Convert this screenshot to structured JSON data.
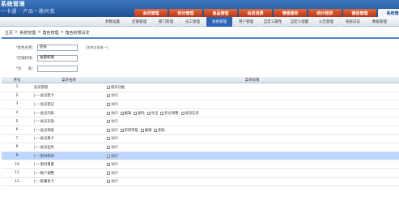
{
  "app": {
    "title": "系统管理",
    "slogan": "一卡通 · 产品一路同我"
  },
  "main_nav": [
    "会员管理",
    "积分管理",
    "商品管理",
    "会员消费",
    "增值服务",
    "统计报表",
    "微信管理",
    "系统管理"
  ],
  "active_main": 7,
  "sub_nav": [
    "参数设置",
    "店铺管理",
    "部门管理",
    "员工管理",
    "角色管理",
    "用户管理",
    "自定义属性",
    "自定义提醒",
    "公告管理",
    "系统日志",
    "数据管理"
  ],
  "active_sub": 4,
  "breadcrumb": [
    "主页",
    "系统管理",
    "角色管理",
    "角色权限设定"
  ],
  "form": {
    "name_label": "*角色名称：",
    "name_value": "店长",
    "hint": "[名称全局唯一]",
    "shop_label": "*店铺权限：",
    "shop_value": "总部权限",
    "remark_label": "*功　　能："
  },
  "table": {
    "headers": {
      "idx": "序号",
      "name": "菜单名称",
      "perm": "菜单权限"
    },
    "rows": [
      {
        "idx": "1",
        "name": "会员管理",
        "perms": [
          "模块功能"
        ]
      },
      {
        "idx": "2",
        "name": "|----会员登卡",
        "perms": [
          "访问"
        ]
      },
      {
        "idx": "3",
        "name": "|----会员登记",
        "perms": [
          "访问"
        ]
      },
      {
        "idx": "4",
        "name": "|----会员列表",
        "perms": [
          "访问",
          "编辑",
          "删除",
          "导出",
          "积分调整",
          "发短信息"
        ]
      },
      {
        "idx": "5",
        "name": "|----会员充值",
        "perms": [
          "访问"
        ]
      },
      {
        "idx": "6",
        "name": "|----会员等级",
        "perms": [
          "访问",
          "新增等级",
          "编辑",
          "删除"
        ]
      },
      {
        "idx": "7",
        "name": "|----会员换卡",
        "perms": [
          "访问"
        ]
      },
      {
        "idx": "8",
        "name": "|----会员挂失",
        "perms": [
          "访问"
        ]
      },
      {
        "idx": "9",
        "name": "|----密码修改",
        "perms": [
          "访问"
        ]
      },
      {
        "idx": "10",
        "name": "|----密码重置",
        "perms": [
          "访问"
        ]
      },
      {
        "idx": "11",
        "name": "|----账户调整",
        "perms": [
          "访问"
        ]
      },
      {
        "idx": "12",
        "name": "|----批量发卡",
        "perms": [
          "访问"
        ]
      }
    ],
    "selected_row": 8
  },
  "colors": {
    "header_blue": "#1f4f93",
    "tab_orange": "#d0532a",
    "selected_row": "#bcd6ff"
  }
}
